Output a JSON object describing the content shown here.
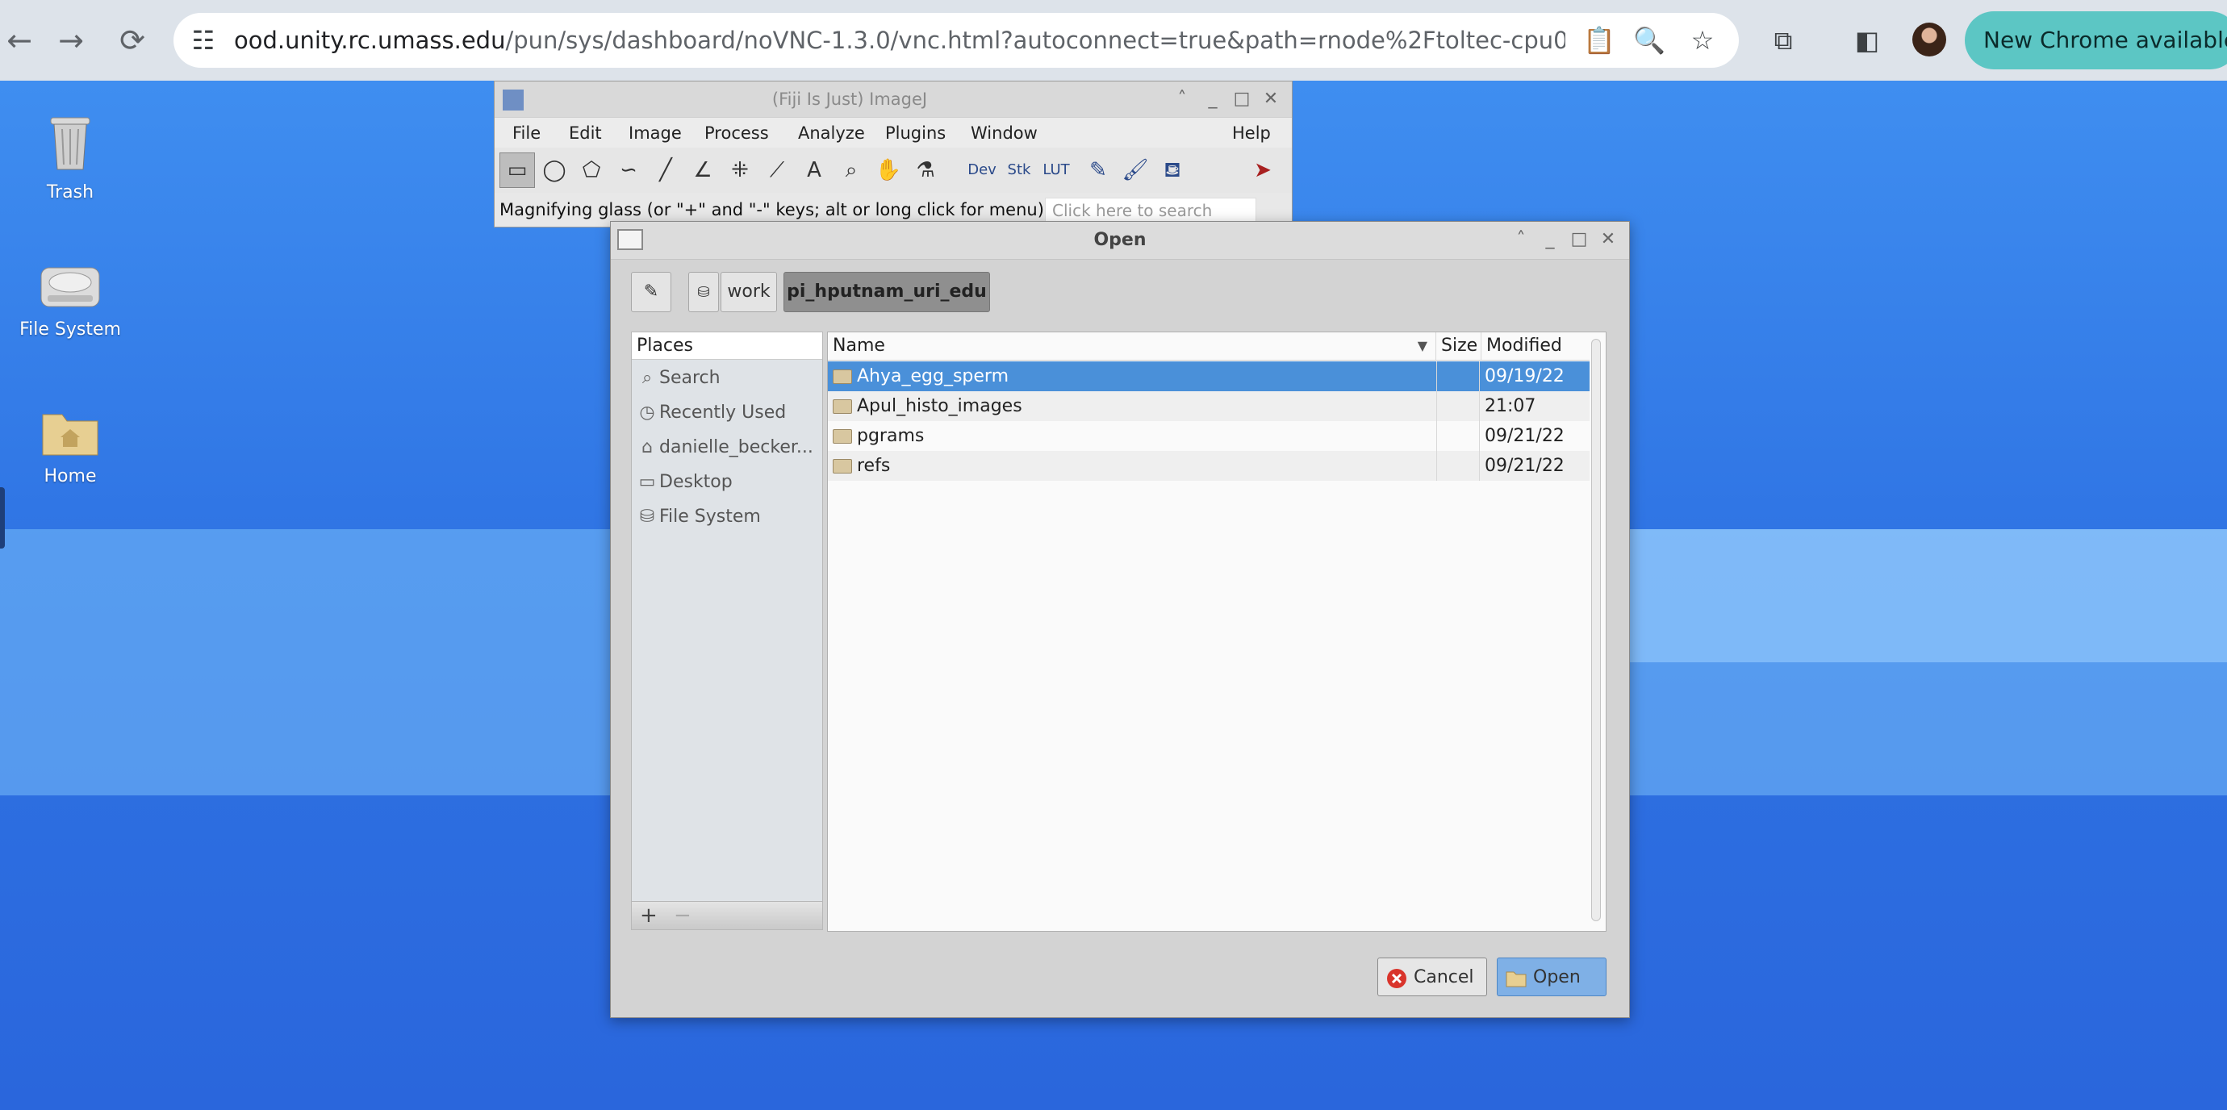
{
  "browser": {
    "url_host": "ood.unity.rc.umass.edu",
    "url_path": "/pun/sys/dashboard/noVNC-1.3.0/vnc.html?autoconnect=true&path=rnode%2Ftoltec-cpu001.unity.r...",
    "update_label": "New Chrome available"
  },
  "desktop": {
    "icons": [
      {
        "label": "Trash"
      },
      {
        "label": "File System"
      },
      {
        "label": "Home"
      }
    ]
  },
  "imagej": {
    "title": "(Fiji Is Just) ImageJ",
    "menu": [
      "File",
      "Edit",
      "Image",
      "Process",
      "Analyze",
      "Plugins",
      "Window",
      "Help"
    ],
    "tools": {
      "dev": "Dev",
      "stk": "Stk",
      "lut": "LUT"
    },
    "status": "Magnifying glass (or \"+\" and \"-\" keys; alt or long click for menu)",
    "search_placeholder": "Click here to search"
  },
  "dialog": {
    "title": "Open",
    "path": [
      "work",
      "pi_hputnam_uri_edu"
    ],
    "places_header": "Places",
    "places": [
      {
        "label": "Search",
        "icon": "search-icon"
      },
      {
        "label": "Recently Used",
        "icon": "clock-icon"
      },
      {
        "label": "danielle_becker...",
        "icon": "home-icon"
      },
      {
        "label": "Desktop",
        "icon": "desktop-icon"
      },
      {
        "label": "File System",
        "icon": "drive-icon"
      }
    ],
    "columns": {
      "name": "Name",
      "size": "Size",
      "modified": "Modified"
    },
    "files": [
      {
        "name": "Ahya_egg_sperm",
        "size": "",
        "modified": "09/19/22",
        "selected": true
      },
      {
        "name": "Apul_histo_images",
        "size": "",
        "modified": "21:07",
        "selected": false
      },
      {
        "name": "pgrams",
        "size": "",
        "modified": "09/21/22",
        "selected": false
      },
      {
        "name": "refs",
        "size": "",
        "modified": "09/21/22",
        "selected": false
      }
    ],
    "cancel_label": "Cancel",
    "open_label": "Open",
    "add_label": "+",
    "remove_label": "−"
  },
  "colors": {
    "selection": "#4a90d9",
    "desktop": "#2f6ee0",
    "update_pill": "#5cc6c4"
  }
}
